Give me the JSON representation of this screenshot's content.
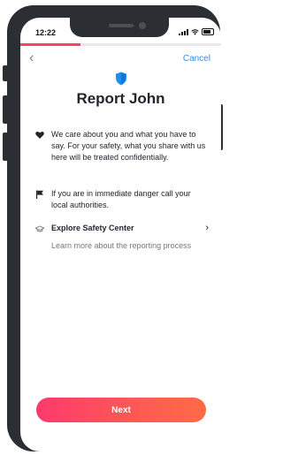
{
  "status_bar": {
    "time": "12:22"
  },
  "nav": {
    "back_glyph": "‹",
    "cancel_label": "Cancel"
  },
  "progress": {
    "fraction": 0.3
  },
  "header": {
    "title": "Report John"
  },
  "items": [
    {
      "icon": "heart-icon",
      "text": "We care about you and what you have to say. For your safety, what you share with us here will be treated confidentially."
    },
    {
      "icon": "flag-icon",
      "text": "If you are in immediate danger call your local authorities."
    }
  ],
  "safety_center": {
    "icon": "hat-icon",
    "title": "Explore Safety Center",
    "subtitle": "Learn more about the reporting process",
    "chevron": "›"
  },
  "footer": {
    "next_label": "Next"
  },
  "colors": {
    "accent": "#fd3f6b",
    "link": "#3f8de0",
    "shield": "#1c8ff2"
  }
}
